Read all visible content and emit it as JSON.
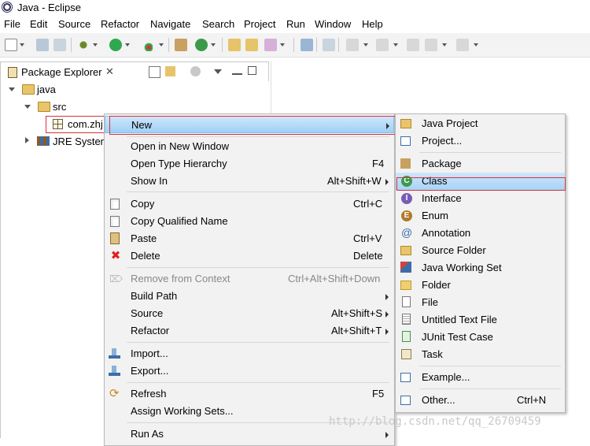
{
  "window": {
    "title": "Java - Eclipse"
  },
  "menubar": [
    "File",
    "Edit",
    "Source",
    "Refactor",
    "Navigate",
    "Search",
    "Project",
    "Run",
    "Window",
    "Help"
  ],
  "package_explorer": {
    "tab_label": "Package Explorer",
    "close_glyph": "✕",
    "tree": [
      {
        "label": "java",
        "level": 0,
        "expanded": true
      },
      {
        "label": "src",
        "level": 1,
        "expanded": true
      },
      {
        "label": "com.zhj",
        "level": 2,
        "selected": true
      },
      {
        "label": "JRE System",
        "level": 1,
        "expanded": false
      }
    ]
  },
  "context_menu": {
    "items": [
      {
        "label": "New",
        "submenu": true,
        "highlighted": true
      },
      {
        "label": "Open in New Window"
      },
      {
        "label": "Open Type Hierarchy",
        "shortcut": "F4"
      },
      {
        "label": "Show In",
        "shortcut": "Alt+Shift+W",
        "submenu": true
      },
      {
        "label": "Copy",
        "shortcut": "Ctrl+C",
        "icon": "copy-icon"
      },
      {
        "label": "Copy Qualified Name",
        "icon": "copy-qualified-icon"
      },
      {
        "label": "Paste",
        "shortcut": "Ctrl+V",
        "icon": "paste-icon"
      },
      {
        "label": "Delete",
        "shortcut": "Delete",
        "icon": "delete-icon"
      },
      {
        "label": "Remove from Context",
        "shortcut": "Ctrl+Alt+Shift+Down",
        "disabled": true,
        "icon": "remove-context-icon"
      },
      {
        "label": "Build Path",
        "submenu": true
      },
      {
        "label": "Source",
        "shortcut": "Alt+Shift+S",
        "submenu": true
      },
      {
        "label": "Refactor",
        "shortcut": "Alt+Shift+T",
        "submenu": true
      },
      {
        "label": "Import...",
        "icon": "import-icon"
      },
      {
        "label": "Export...",
        "icon": "export-icon"
      },
      {
        "label": "Refresh",
        "shortcut": "F5",
        "icon": "refresh-icon"
      },
      {
        "label": "Assign Working Sets..."
      },
      {
        "label": "Run As",
        "submenu": true
      }
    ]
  },
  "new_submenu": {
    "items": [
      {
        "label": "Java Project",
        "icon": "java-project-icon"
      },
      {
        "label": "Project...",
        "icon": "project-icon"
      },
      {
        "label": "Package",
        "icon": "package-icon"
      },
      {
        "label": "Class",
        "icon": "class-icon",
        "highlighted": true
      },
      {
        "label": "Interface",
        "icon": "interface-icon"
      },
      {
        "label": "Enum",
        "icon": "enum-icon"
      },
      {
        "label": "Annotation",
        "icon": "annotation-icon"
      },
      {
        "label": "Source Folder",
        "icon": "source-folder-icon"
      },
      {
        "label": "Java Working Set",
        "icon": "working-set-icon"
      },
      {
        "label": "Folder",
        "icon": "folder-icon"
      },
      {
        "label": "File",
        "icon": "file-icon"
      },
      {
        "label": "Untitled Text File",
        "icon": "text-file-icon"
      },
      {
        "label": "JUnit Test Case",
        "icon": "junit-icon"
      },
      {
        "label": "Task",
        "icon": "task-icon"
      },
      {
        "label": "Example...",
        "icon": "example-icon"
      },
      {
        "label": "Other...",
        "shortcut": "Ctrl+N",
        "icon": "other-icon"
      }
    ]
  },
  "watermark": "http://blog.csdn.net/qq_26709459",
  "colors": {
    "highlight": "#9fd0f7",
    "redbox": "#d8333a",
    "menu_bg": "#f2f2f2"
  }
}
